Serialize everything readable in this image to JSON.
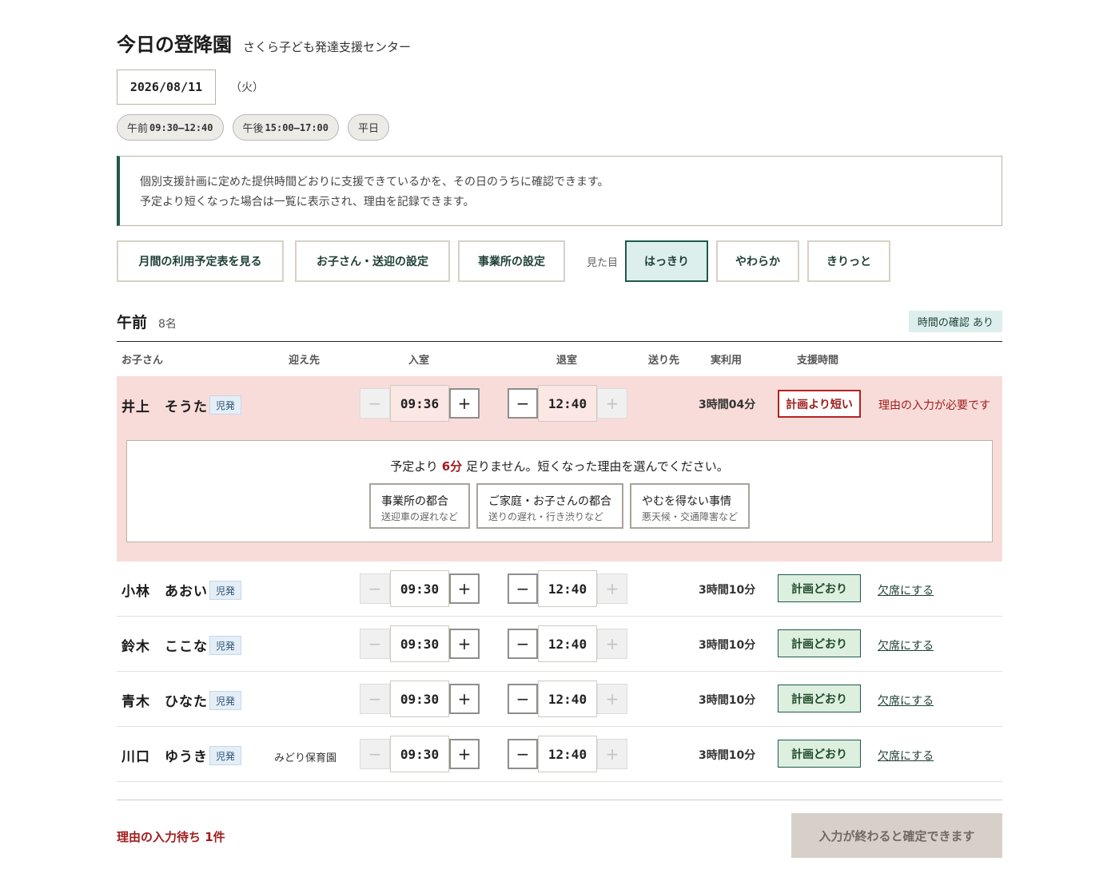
{
  "header": {
    "title": "今日の登降園",
    "facility": "さくら子ども発達支援センター",
    "date": "2026/08/11",
    "weekday": "（火）"
  },
  "chips": [
    {
      "label": "午前",
      "time": "09:30–12:40"
    },
    {
      "label": "午後",
      "time": "15:00–17:00"
    },
    {
      "label": "平日",
      "time": ""
    }
  ],
  "notice": {
    "line1": "個別支援計画に定めた提供時間どおりに支援できているかを、その日のうちに確認できます。",
    "line2": "予定より短くなった場合は一覧に表示され、理由を記録できます。"
  },
  "toolbar": {
    "monthly_label": "月間の利用予定表を見る",
    "children_label": "お子さん・送迎の設定",
    "office_label": "事業所の設定",
    "look_label": "見た目",
    "themes": [
      "はっきり",
      "やわらか",
      "きりっと"
    ],
    "active_theme": "はっきり"
  },
  "section": {
    "title": "午前",
    "count": "8名",
    "badge": "時間の確認 あり"
  },
  "columns": {
    "child": "お子さん",
    "pickup": "迎え先",
    "in": "入室",
    "out": "退室",
    "dropoff": "送り先",
    "used": "実利用",
    "support": "支援時間"
  },
  "stepper": {
    "minus": "−",
    "plus": "+"
  },
  "rows": [
    {
      "name": "井上　そうた",
      "tag": "児発",
      "pickup": "",
      "in": "09:36",
      "out": "12:40",
      "used": "3時間04分",
      "status": "計画より短い",
      "note": "理由の入力が必要です"
    },
    {
      "name": "小林　あおい",
      "tag": "児発",
      "pickup": "",
      "in": "09:30",
      "out": "12:40",
      "used": "3時間10分",
      "status": "計画どおり",
      "note": "欠席にする"
    },
    {
      "name": "鈴木　ここな",
      "tag": "児発",
      "pickup": "",
      "in": "09:30",
      "out": "12:40",
      "used": "3時間10分",
      "status": "計画どおり",
      "note": "欠席にする"
    },
    {
      "name": "青木　ひなた",
      "tag": "児発",
      "pickup": "",
      "in": "09:30",
      "out": "12:40",
      "used": "3時間10分",
      "status": "計画どおり",
      "note": "欠席にする"
    },
    {
      "name": "川口　ゆうき",
      "tag": "児発",
      "pickup": "みどり保育園",
      "in": "09:30",
      "out": "12:40",
      "used": "3時間10分",
      "status": "計画どおり",
      "note": "欠席にする"
    }
  ],
  "reason": {
    "prefix": "予定より",
    "minutes": "6分",
    "suffix": "足りません。短くなった理由を選んでください。",
    "options": [
      {
        "main": "事業所の都合",
        "sub": "送迎車の遅れなど"
      },
      {
        "main": "ご家庭・お子さんの都合",
        "sub": "送りの遅れ・行き渋りなど"
      },
      {
        "main": "やむを得ない事情",
        "sub": "悪天候・交通障害など"
      }
    ]
  },
  "footer": {
    "pending": "理由の入力待ち 1件",
    "confirm": "入力が終わると確定できます"
  },
  "colors": {
    "accent": "#1e5a4a",
    "alert_bg": "#f8dcd9",
    "alert_text": "#a11d1d",
    "ok_bg": "#ddefdf"
  }
}
